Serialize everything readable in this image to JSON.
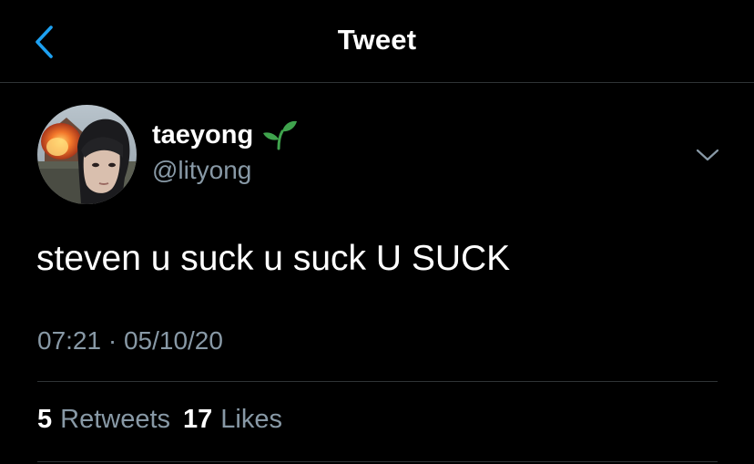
{
  "colors": {
    "background": "#000000",
    "accent": "#1da1f2",
    "secondary_text": "#8899a6",
    "divider": "#2f3336",
    "sprout_green": "#3fa34d"
  },
  "header": {
    "back_icon": "chevron-left-icon",
    "title": "Tweet"
  },
  "author": {
    "display_name": "taeyong",
    "emoji_icon": "seedling-emoji-icon",
    "handle": "@lityong",
    "avatar": "avatar-photo"
  },
  "tweet": {
    "text": "steven u suck u suck U SUCK",
    "timestamp": "07:21 · 05/10/20",
    "more_icon": "chevron-down-icon"
  },
  "stats": {
    "retweets_count": "5",
    "retweets_label": "Retweets",
    "likes_count": "17",
    "likes_label": "Likes"
  }
}
